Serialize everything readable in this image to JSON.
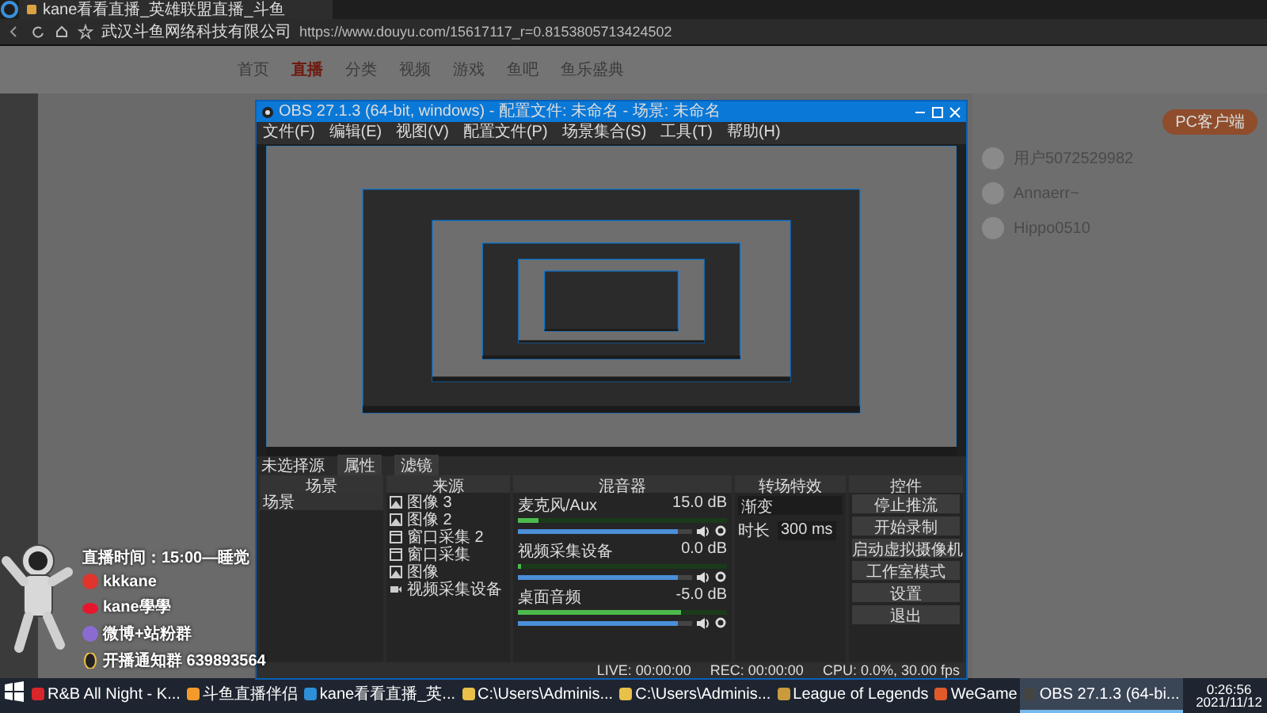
{
  "browser": {
    "tab": {
      "title": "kane看看直播_英雄联盟直播_斗鱼"
    },
    "site_owner": "武汉斗鱼网络科技有限公司",
    "url": "https://www.douyu.com/15617117_r=0.8153805713424502",
    "nav": [
      {
        "label": "首页",
        "selected": false
      },
      {
        "label": "直播",
        "selected": true
      },
      {
        "label": "分类",
        "selected": false
      },
      {
        "label": "视频",
        "selected": false
      },
      {
        "label": "游戏",
        "selected": false
      },
      {
        "label": "鱼吧",
        "selected": false
      },
      {
        "label": "鱼乐盛典",
        "selected": false
      }
    ],
    "side_panel": {
      "button": "PC客户端",
      "users": [
        "用户5072529982",
        "Annaerr~",
        "Hippo0510"
      ]
    }
  },
  "obs": {
    "title": "OBS 27.1.3 (64-bit, windows) - 配置文件: 未命名 - 场景: 未命名",
    "menu": [
      "文件(F)",
      "编辑(E)",
      "视图(V)",
      "配置文件(P)",
      "场景集合(S)",
      "工具(T)",
      "帮助(H)"
    ],
    "source_bar": {
      "label": "未选择源",
      "buttons": [
        "属性",
        "滤镜"
      ]
    },
    "docks": {
      "scenes": "场景",
      "sources": "来源",
      "mixer": "混音器",
      "transitions": "转场特效",
      "controls": "控件"
    },
    "scenes": [
      "场景"
    ],
    "sources": [
      {
        "name": "图像 3",
        "kind": "image"
      },
      {
        "name": "图像 2",
        "kind": "image"
      },
      {
        "name": "窗口采集 2",
        "kind": "window"
      },
      {
        "name": "窗口采集",
        "kind": "window"
      },
      {
        "name": "图像",
        "kind": "image"
      },
      {
        "name": "视频采集设备",
        "kind": "camera"
      }
    ],
    "mixer": [
      {
        "name": "麦克风/Aux",
        "reading": "15.0 dB",
        "level": 0.1,
        "volume_slider": {
          "level": 0.92
        }
      },
      {
        "name": "视频采集设备",
        "reading": "0.0 dB",
        "level": 0,
        "volume_slider": {
          "level": 0.92
        }
      },
      {
        "name": "桌面音频",
        "reading": "-5.0 dB",
        "level": 0.78,
        "volume_slider": {
          "level": 0.92
        }
      }
    ],
    "transition": {
      "type": "渐变",
      "duration_label": "时长",
      "duration": "300 ms"
    },
    "controls": [
      "停止推流",
      "开始录制",
      "启动虚拟摄像机",
      "工作室模式",
      "设置",
      "退出"
    ],
    "status": [
      "LIVE: 00:00:00",
      "REC: 00:00:00",
      "CPU: 0.0%, 30.00 fps"
    ]
  },
  "overlay": {
    "schedule": "直播时间：15:00—睡觉",
    "items": [
      {
        "kind": "netease",
        "text": "kkkane"
      },
      {
        "kind": "weibo",
        "text": "kane學學"
      },
      {
        "kind": "fans",
        "text": "微博+站粉群"
      },
      {
        "kind": "qq",
        "text": "开播通知群 639893564"
      }
    ]
  },
  "taskbar": {
    "apps": [
      {
        "label": "R&B All Night - K...",
        "kind": "music",
        "selected": false
      },
      {
        "label": "斗鱼直播伴侣",
        "kind": "stream",
        "selected": false
      },
      {
        "label": "kane看看直播_英...",
        "kind": "browser",
        "selected": false
      },
      {
        "label": "C:\\Users\\Adminis...",
        "kind": "folder",
        "selected": false
      },
      {
        "label": "C:\\Users\\Adminis...",
        "kind": "folder",
        "selected": false
      },
      {
        "label": "League of Legends",
        "kind": "game",
        "selected": false
      },
      {
        "label": "WeGame",
        "kind": "game2",
        "selected": false
      },
      {
        "label": "OBS 27.1.3 (64-bi...",
        "kind": "obs",
        "selected": true
      }
    ],
    "time": "0:26:56",
    "date": "2021/11/12"
  }
}
